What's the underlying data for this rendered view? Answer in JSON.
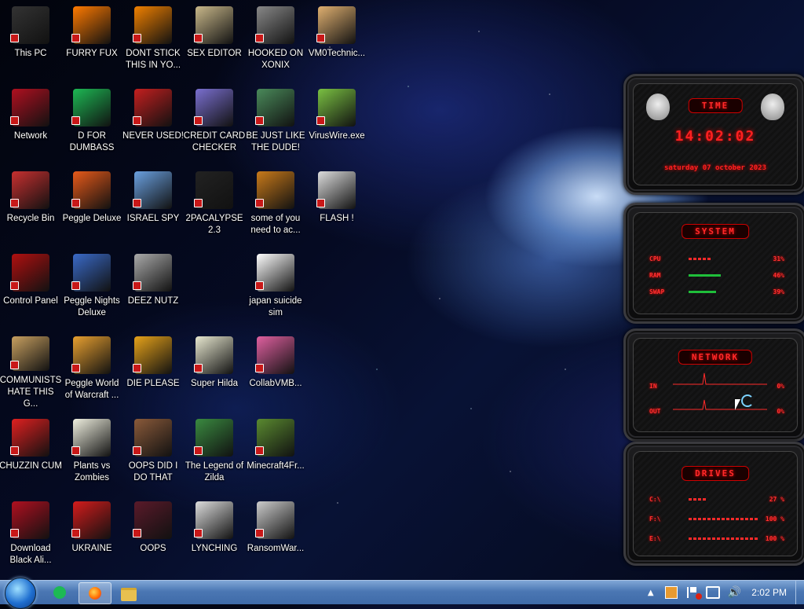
{
  "desktop": {
    "icons": [
      {
        "label": "This PC",
        "icon": "computer-icon",
        "color": "#333"
      },
      {
        "label": "FURRY FUX",
        "icon": "firefox-icon",
        "color": "#ff7a00"
      },
      {
        "label": "DONT STICK THIS IN YO...",
        "icon": "vlc-cone-icon",
        "color": "#f08000"
      },
      {
        "label": "SEX EDITOR",
        "icon": "hxd-hex-editor-icon",
        "color": "#c9b88a"
      },
      {
        "label": "HOOKED ON XONIX",
        "icon": "xonix-game-icon",
        "color": "#888"
      },
      {
        "label": "VM0Technic...",
        "icon": "doctor-person-icon",
        "color": "#e0b070"
      },
      {
        "label": "Network",
        "icon": "alien-network-icon",
        "color": "#b01020"
      },
      {
        "label": "D FOR DUMBASS",
        "icon": "spotify-green-icon",
        "color": "#1db954"
      },
      {
        "label": "NEVER USED!",
        "icon": "dev-cpp-icon",
        "color": "#c41f1f"
      },
      {
        "label": "CREDIT CARD CHECKER",
        "icon": "credit-card-icon",
        "color": "#7a6fd0"
      },
      {
        "label": "BE JUST LIKE THE DUDE!",
        "icon": "santa-cartoon-icon",
        "color": "#4a8a5a"
      },
      {
        "label": "VirusWire.exe",
        "icon": "lime-green-icon",
        "color": "#7ac142"
      },
      {
        "label": "Recycle Bin",
        "icon": "recycle-bin-icon",
        "color": "#c83030"
      },
      {
        "label": "Peggle Deluxe",
        "icon": "peggle-icon",
        "color": "#e85a1a"
      },
      {
        "label": "ISRAEL SPY",
        "icon": "network-spy-icon",
        "color": "#6aa0e0"
      },
      {
        "label": "2PACALYPSE 2.3",
        "icon": "terminal-icon",
        "color": "#222"
      },
      {
        "label": "some of you need to ac...",
        "icon": "pixel-dog-icon",
        "color": "#c97a1a"
      },
      {
        "label": "FLASH !",
        "icon": "flash-document-icon",
        "color": "#ddd"
      },
      {
        "label": "Control Panel",
        "icon": "control-panel-icon",
        "color": "#b01010"
      },
      {
        "label": "Peggle Nights Deluxe",
        "icon": "peggle-nights-icon",
        "color": "#3a6ac8"
      },
      {
        "label": "DEEZ NUTZ",
        "icon": "stacked-windows-icon",
        "color": "#aaa"
      },
      {
        "label": "",
        "icon": "",
        "color": ""
      },
      {
        "label": "japan suicide sim",
        "icon": "document-icon",
        "color": "#fff"
      },
      {
        "label": "",
        "icon": "",
        "color": ""
      },
      {
        "label": "COMMUNISTS HATE THIS G...",
        "icon": "money-bag-icon",
        "color": "#c8a060"
      },
      {
        "label": "Peggle World of Warcraft ...",
        "icon": "peggle-wow-icon",
        "color": "#e8a030"
      },
      {
        "label": "DIE PLEASE",
        "icon": "de-font-icon",
        "color": "#e6a21a"
      },
      {
        "label": "Super Hilda",
        "icon": "pixel-cat-icon",
        "color": "#e8e8d0"
      },
      {
        "label": "CollabVMB...",
        "icon": "monitor-icon",
        "color": "#e060a0"
      },
      {
        "label": "",
        "icon": "",
        "color": ""
      },
      {
        "label": "CHUZZIN CUM",
        "icon": "chuzzle-icon",
        "color": "#e02020"
      },
      {
        "label": "Plants vs Zombies",
        "icon": "plant-flower-icon",
        "color": "#f0f0e0"
      },
      {
        "label": "OOPS DID I DO THAT",
        "icon": "portrait-painting-icon",
        "color": "#8a5a3a"
      },
      {
        "label": "The Legend of Zilda",
        "icon": "pixel-hero-icon",
        "color": "#3a8a40"
      },
      {
        "label": "Minecraft4Fr...",
        "icon": "grass-block-icon",
        "color": "#5a8a30"
      },
      {
        "label": "",
        "icon": "",
        "color": ""
      },
      {
        "label": "Download Black Ali...",
        "icon": "alien-head-icon",
        "color": "#b01020"
      },
      {
        "label": "UKRAINE",
        "icon": "radiation-icon",
        "color": "#d41c1c"
      },
      {
        "label": "OOPS",
        "icon": "red-book-icon",
        "color": "#5a1a2a"
      },
      {
        "label": "LYNCHING",
        "icon": "shield-crest-icon",
        "color": "#ddd"
      },
      {
        "label": "RansomWar...",
        "icon": "skull-icon",
        "color": "#ccc"
      },
      {
        "label": "",
        "icon": "",
        "color": ""
      }
    ]
  },
  "widgets": {
    "time": {
      "title": "TIME",
      "clock": "14:02:02",
      "date": "saturday 07 october 2023"
    },
    "system": {
      "title": "SYSTEM",
      "rows": [
        {
          "label": "CPU",
          "value": "31%",
          "fill": 0.31
        },
        {
          "label": "RAM",
          "value": "46%",
          "fill": 0.46
        },
        {
          "label": "SWAP",
          "value": "39%",
          "fill": 0.39
        }
      ]
    },
    "network": {
      "title": "NETWORK",
      "rows": [
        {
          "label": "IN",
          "value": "0%"
        },
        {
          "label": "OUT",
          "value": "0%"
        }
      ]
    },
    "drives": {
      "title": "DRIVES",
      "rows": [
        {
          "label": "C:\\",
          "value": "27 %",
          "fill": 0.27
        },
        {
          "label": "F:\\",
          "value": "100 %",
          "fill": 1.0
        },
        {
          "label": "E:\\",
          "value": "100 %",
          "fill": 1.0
        }
      ]
    }
  },
  "taskbar": {
    "clock": "2:02 PM",
    "pinned": [
      {
        "icon": "spotify-green-icon",
        "color": "#1db954"
      },
      {
        "icon": "firefox-icon",
        "color": "#ff7a00"
      },
      {
        "icon": "folder-icon",
        "color": "#e8c050"
      }
    ],
    "tray": [
      "show-hidden-icons-icon",
      "network-manager-icon",
      "action-center-flag-icon",
      "network-icon",
      "volume-icon"
    ]
  },
  "colors": {
    "accent_red": "#ff2a2a"
  }
}
